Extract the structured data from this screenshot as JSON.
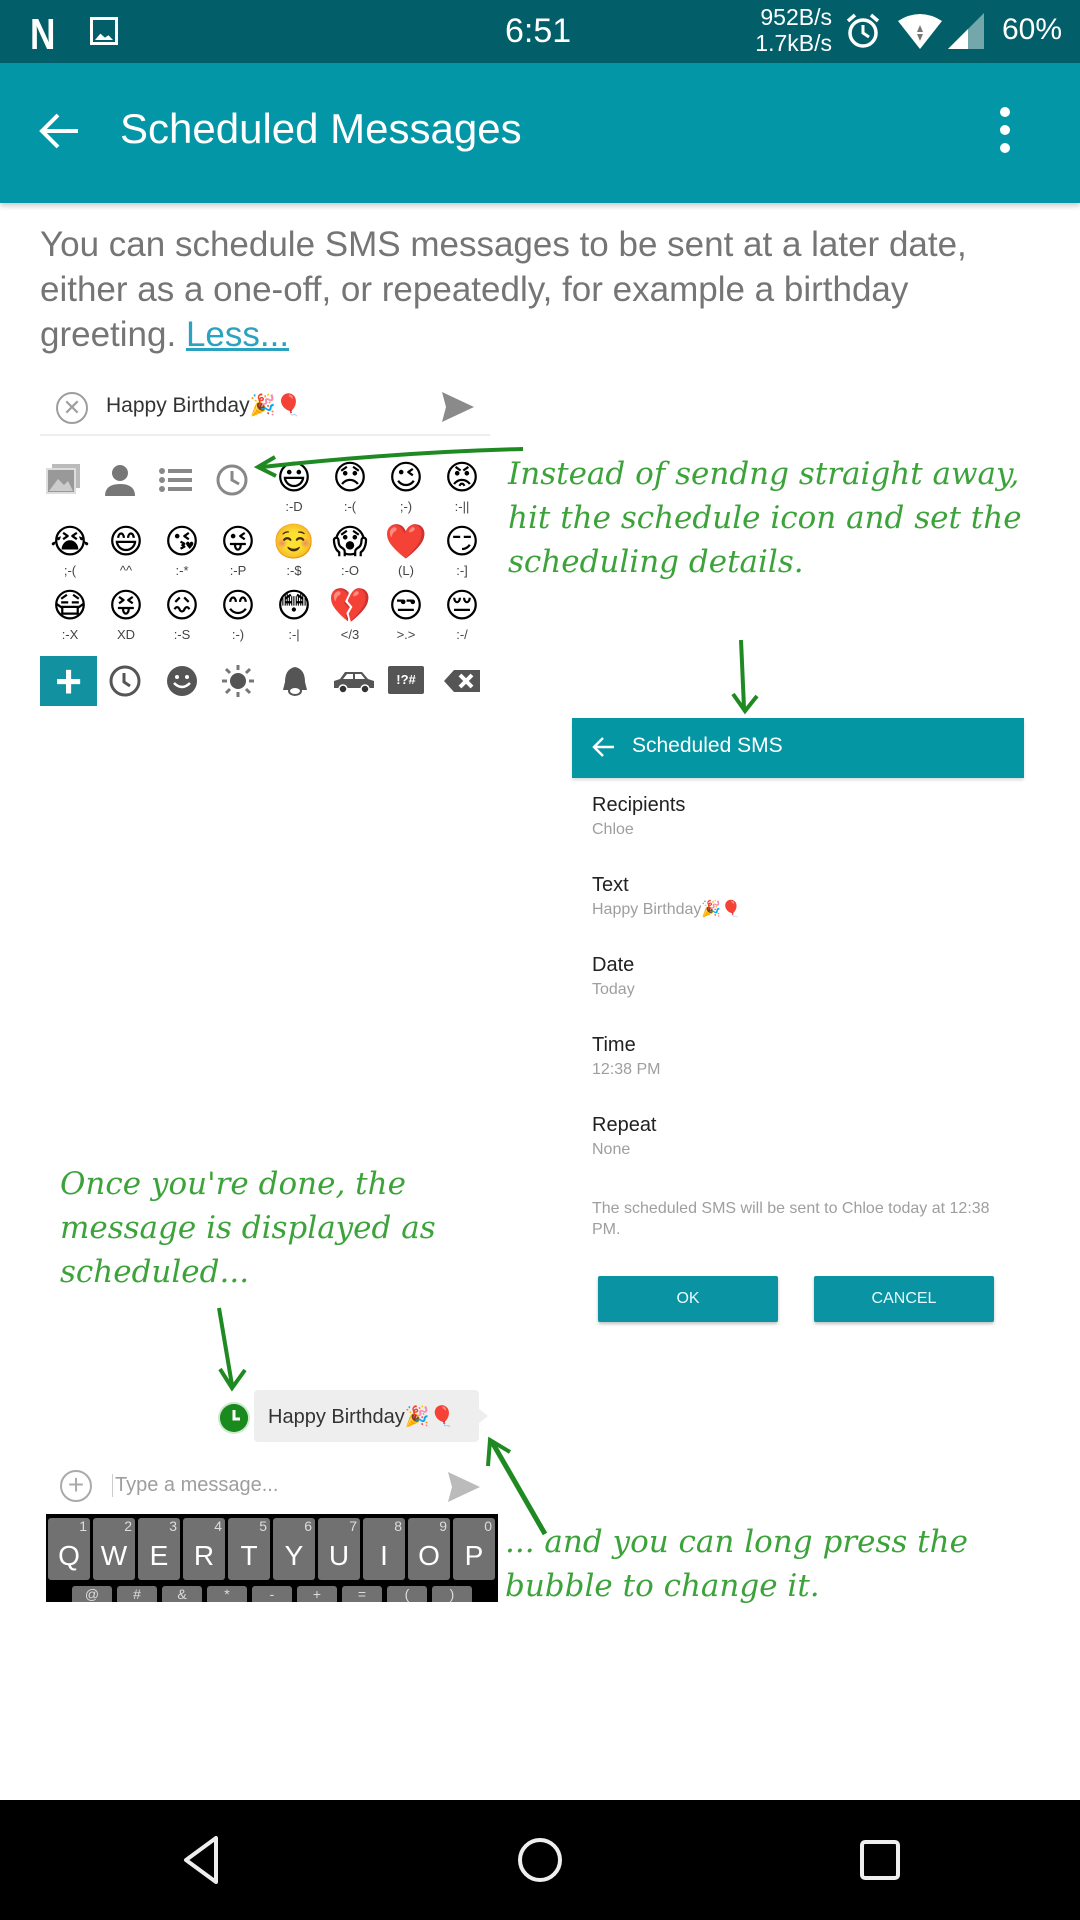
{
  "status_bar": {
    "notification_app": "N",
    "time": "6:51",
    "net_up": "952B/s",
    "net_down": "1.7kB/s",
    "battery": "60%",
    "icons": [
      "notification-n-icon",
      "image-notification-icon",
      "alarm-icon",
      "wifi-icon",
      "cell-signal-icon"
    ]
  },
  "app_bar": {
    "title": "Scheduled Messages",
    "back_icon": "arrow-left-icon",
    "menu_icon": "more-vert-icon"
  },
  "description": {
    "text": "You can schedule SMS messages to be sent at a later date, either as a one-off, or repeatedly, for example a birthday greeting. ",
    "link": "Less..."
  },
  "illustration": {
    "compose": {
      "message": "Happy Birthday🎉🎈"
    },
    "emoji_rows": [
      [
        {
          "glyph": "😃",
          "code": ":-D"
        },
        {
          "glyph": "😞",
          "code": ":-("
        },
        {
          "glyph": "😉",
          "code": ";-)"
        },
        {
          "glyph": "😡",
          "code": ":-||"
        }
      ],
      [
        {
          "glyph": "😭",
          "code": ";-("
        },
        {
          "glyph": "😄",
          "code": "^^"
        },
        {
          "glyph": "😘",
          "code": ":-*"
        },
        {
          "glyph": "😜",
          "code": ":-P"
        },
        {
          "glyph": "☺️",
          "code": ":-$"
        },
        {
          "glyph": "😱",
          "code": ":-O"
        },
        {
          "glyph": "❤️",
          "code": "(L)"
        },
        {
          "glyph": "😏",
          "code": ":-]"
        }
      ],
      [
        {
          "glyph": "😷",
          "code": ":-X"
        },
        {
          "glyph": "😝",
          "code": "XD"
        },
        {
          "glyph": "😖",
          "code": ":-S"
        },
        {
          "glyph": "😊",
          "code": ":-)"
        },
        {
          "glyph": "😳",
          "code": ":-|"
        },
        {
          "glyph": "💔",
          "code": "</3"
        },
        {
          "glyph": "😒",
          "code": ">.>"
        },
        {
          "glyph": "😔",
          "code": ":-/"
        }
      ]
    ],
    "emoji_bar": {
      "plus": "+",
      "symbols_label": "!?#"
    },
    "annotation_1": "Instead of sendng straight away, hit the schedule icon and set the scheduling details.",
    "annotation_2": "Once you're done, the message is displayed as scheduled...",
    "annotation_3": "... and you can long press the bubble to change it.",
    "dialog": {
      "title": "Scheduled SMS",
      "fields": [
        {
          "label": "Recipients",
          "value": "Chloe"
        },
        {
          "label": "Text",
          "value": "Happy Birthday🎉🎈"
        },
        {
          "label": "Date",
          "value": "Today"
        },
        {
          "label": "Time",
          "value": "12:38 PM"
        },
        {
          "label": "Repeat",
          "value": "None"
        }
      ],
      "summary": "The scheduled SMS will be sent to Chloe today at 12:38 PM.",
      "ok_label": "OK",
      "cancel_label": "CANCEL"
    },
    "bubble_text": "Happy Birthday🎉🎈",
    "type_placeholder": "Type a message...",
    "keyboard": {
      "keys": [
        "Q",
        "W",
        "E",
        "R",
        "T",
        "Y",
        "U",
        "I",
        "O",
        "P"
      ],
      "numbers": [
        "1",
        "2",
        "3",
        "4",
        "5",
        "6",
        "7",
        "8",
        "9",
        "0"
      ],
      "second_row": [
        "@",
        "#",
        "&",
        "*",
        "-",
        "+",
        "=",
        "(",
        ")"
      ]
    }
  },
  "nav_bar": {
    "icons": [
      "back-triangle-icon",
      "home-circle-icon",
      "recents-square-icon"
    ]
  },
  "colors": {
    "status_bar": "#025f69",
    "app_bar": "#0396a6",
    "link": "#2aa3c0",
    "annotation_green": "#3ca33a"
  }
}
